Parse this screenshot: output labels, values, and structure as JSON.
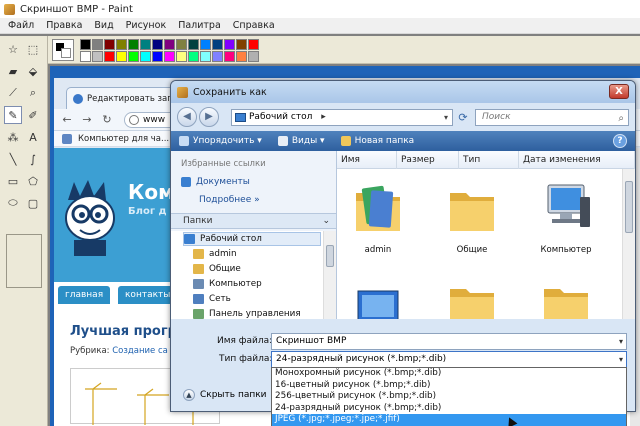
{
  "paint": {
    "title": "Скриншот BMP - Paint",
    "menu": [
      "Файл",
      "Правка",
      "Вид",
      "Рисунок",
      "Палитра",
      "Справка"
    ],
    "tools": [
      {
        "name": "free-select-icon",
        "glyph": "☆"
      },
      {
        "name": "rect-select-icon",
        "glyph": "⬚"
      },
      {
        "name": "eraser-icon",
        "glyph": "▰"
      },
      {
        "name": "fill-icon",
        "glyph": "⬙"
      },
      {
        "name": "eyedropper-icon",
        "glyph": "⟋"
      },
      {
        "name": "magnifier-icon",
        "glyph": "⌕"
      },
      {
        "name": "pencil-icon",
        "glyph": "✎"
      },
      {
        "name": "brush-icon",
        "glyph": "✐"
      },
      {
        "name": "airbrush-icon",
        "glyph": "⁂"
      },
      {
        "name": "text-icon",
        "glyph": "A"
      },
      {
        "name": "line-icon",
        "glyph": "╲"
      },
      {
        "name": "curve-icon",
        "glyph": "∫"
      },
      {
        "name": "rectangle-icon",
        "glyph": "▭"
      },
      {
        "name": "polygon-icon",
        "glyph": "⬠"
      },
      {
        "name": "ellipse-icon",
        "glyph": "⬭"
      },
      {
        "name": "rounded-rect-icon",
        "glyph": "▢"
      }
    ],
    "palette_top": [
      "#000000",
      "#808080",
      "#800000",
      "#808000",
      "#008000",
      "#008080",
      "#000080",
      "#800080",
      "#808040",
      "#004040",
      "#0080ff",
      "#004080",
      "#8000ff",
      "#804000",
      "#ff0000"
    ],
    "palette_bottom": [
      "#ffffff",
      "#c0c0c0",
      "#ff0000",
      "#ffff00",
      "#00ff00",
      "#00ffff",
      "#0000ff",
      "#ff00ff",
      "#ffff80",
      "#00ff80",
      "#80ffff",
      "#8080ff",
      "#ff0080",
      "#ff8040",
      "#b0b0b0"
    ]
  },
  "browser": {
    "tab_title": "Редактировать запис",
    "address": "www",
    "bookmark": "Компьютер для ча...",
    "site_logo": "Ком",
    "site_sub": "Блог д",
    "nav": [
      "главная",
      "контакты"
    ],
    "post_title": "Лучшая прогр",
    "rubric_label": "Рубрика:",
    "rubric_link": "Создание са"
  },
  "dialog": {
    "title": "Сохранить как",
    "close_glyph": "X",
    "path": "Рабочий стол",
    "path_arrow": "▸",
    "search_placeholder": "Поиск",
    "toolbar": {
      "organize": "Упорядочить ▾",
      "views": "Виды ▾",
      "new_folder": "Новая папка",
      "help": "?"
    },
    "favorites_header": "Избранные ссылки",
    "favorites": [
      "Документы"
    ],
    "more": "Подробнее »",
    "folders_header": "Папки",
    "folders_chevron": "⌄",
    "tree": [
      {
        "label": "Рабочий стол",
        "color": "#3a7fd0",
        "selected": true
      },
      {
        "label": "admin",
        "color": "#e3b649",
        "selected": false
      },
      {
        "label": "Общие",
        "color": "#e3b649",
        "selected": false
      },
      {
        "label": "Компьютер",
        "color": "#6b8bb3",
        "selected": false
      },
      {
        "label": "Сеть",
        "color": "#4f7fbf",
        "selected": false
      },
      {
        "label": "Панель управления",
        "color": "#6aa36a",
        "selected": false
      },
      {
        "label": "",
        "color": "#4f7fbf",
        "selected": false
      }
    ],
    "columns": [
      "Имя",
      "Размер",
      "Тип",
      "Дата изменения"
    ],
    "files": [
      {
        "label": "admin",
        "kind": "user-folder"
      },
      {
        "label": "Общие",
        "kind": "folder"
      },
      {
        "label": "Компьютер",
        "kind": "computer"
      },
      {
        "label": "",
        "kind": "network"
      },
      {
        "label": "",
        "kind": "folder"
      },
      {
        "label": "",
        "kind": "folder"
      }
    ],
    "filename_label": "Имя файла:",
    "filename_value": "Скриншот BMP",
    "filetype_label": "Тип файла:",
    "filetype_value": "24-разрядный рисунок (*.bmp;*.dib)",
    "hide_folders": "Скрыть папки",
    "dropdown_glyph": "▾"
  },
  "filetype_options": [
    {
      "label": "Монохромный рисунок (*.bmp;*.dib)",
      "highlighted": false
    },
    {
      "label": "16-цветный рисунок (*.bmp;*.dib)",
      "highlighted": false
    },
    {
      "label": "256-цветный рисунок (*.bmp;*.dib)",
      "highlighted": false
    },
    {
      "label": "24-разрядный рисунок (*.bmp;*.dib)",
      "highlighted": false
    },
    {
      "label": "JPEG (*.jpg;*.jpeg;*.jpe;*.jfif)",
      "highlighted": true
    }
  ]
}
